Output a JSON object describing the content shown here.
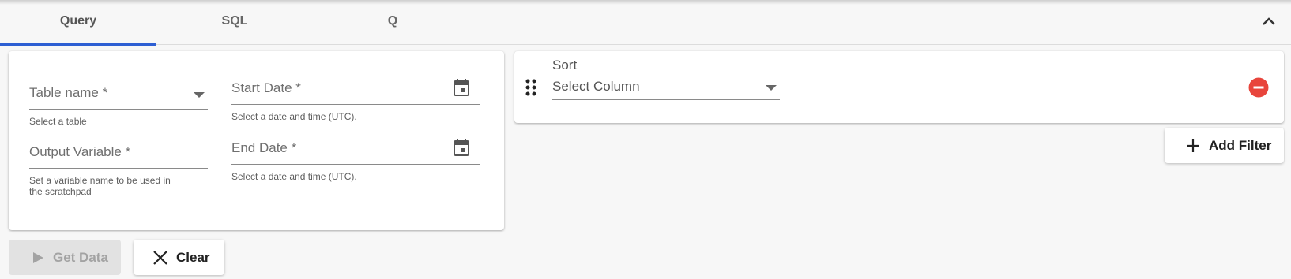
{
  "tabs": [
    {
      "label": "Query",
      "active": true
    },
    {
      "label": "SQL",
      "active": false
    },
    {
      "label": "Q",
      "active": false
    }
  ],
  "form": {
    "table_name": {
      "label": "Table name *",
      "hint": "Select a table"
    },
    "output_variable": {
      "label": "Output Variable *",
      "hint_line1": "Set a variable name to be used in",
      "hint_line2": "the scratchpad"
    },
    "start_date": {
      "label": "Start Date *",
      "hint": "Select a date and time (UTC)."
    },
    "end_date": {
      "label": "End Date *",
      "hint": "Select a date and time (UTC)."
    }
  },
  "actions": {
    "get_data_label": "Get Data",
    "clear_label": "Clear"
  },
  "sort": {
    "title": "Sort",
    "select_placeholder": "Select Column"
  },
  "add_filter_label": "Add Filter",
  "colors": {
    "accent": "#2d5fd3",
    "remove": "#e8453c"
  },
  "icons": [
    "chevron-up-icon",
    "dropdown-arrow-icon",
    "calendar-icon",
    "drag-handle-icon",
    "remove-circle-icon",
    "play-icon",
    "close-icon",
    "plus-icon"
  ]
}
